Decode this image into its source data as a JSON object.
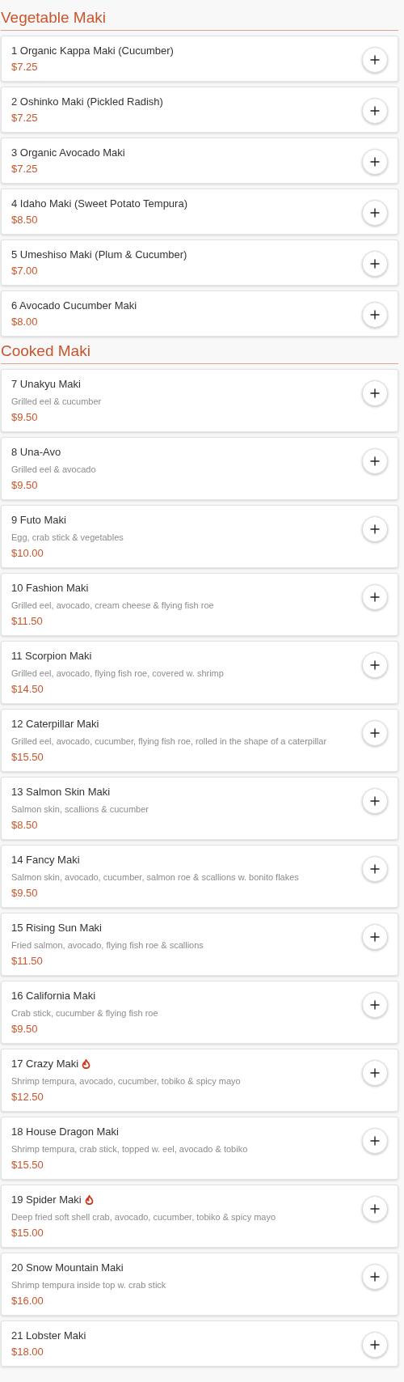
{
  "sections": [
    {
      "title": "Vegetable Maki",
      "items": [
        {
          "name": "1 Organic Kappa Maki (Cucumber)",
          "price": "$7.25",
          "spicy": false
        },
        {
          "name": "2 Oshinko Maki (Pickled Radish)",
          "price": "$7.25",
          "spicy": false
        },
        {
          "name": "3 Organic Avocado Maki",
          "price": "$7.25",
          "spicy": false
        },
        {
          "name": "4 Idaho Maki (Sweet Potato Tempura)",
          "price": "$8.50",
          "spicy": false
        },
        {
          "name": "5 Umeshiso Maki (Plum & Cucumber)",
          "price": "$7.00",
          "spicy": false
        },
        {
          "name": "6 Avocado Cucumber Maki",
          "price": "$8.00",
          "spicy": false
        }
      ]
    },
    {
      "title": "Cooked Maki",
      "items": [
        {
          "name": "7 Unakyu Maki",
          "description": "Grilled eel & cucumber",
          "price": "$9.50",
          "spicy": false
        },
        {
          "name": "8 Una-Avo",
          "description": "Grilled eel & avocado",
          "price": "$9.50",
          "spicy": false
        },
        {
          "name": "9 Futo Maki",
          "description": "Egg, crab stick & vegetables",
          "price": "$10.00",
          "spicy": false
        },
        {
          "name": "10 Fashion Maki",
          "description": "Grilled eel, avocado, cream cheese & flying fish roe",
          "price": "$11.50",
          "spicy": false
        },
        {
          "name": "11 Scorpion Maki",
          "description": "Grilled eel, avocado, flying fish roe, covered w. shrimp",
          "price": "$14.50",
          "spicy": false
        },
        {
          "name": "12 Caterpillar Maki",
          "description": "Grilled eel, avocado, cucumber, flying fish roe, rolled in the shape of a caterpillar",
          "price": "$15.50",
          "spicy": false
        },
        {
          "name": "13 Salmon Skin Maki",
          "description": "Salmon skin, scallions & cucumber",
          "price": "$8.50",
          "spicy": false
        },
        {
          "name": "14 Fancy Maki",
          "description": "Salmon skin, avocado, cucumber, salmon roe & scallions w. bonito flakes",
          "price": "$9.50",
          "spicy": false
        },
        {
          "name": "15 Rising Sun Maki",
          "description": "Fried salmon, avocado, flying fish roe & scallions",
          "price": "$11.50",
          "spicy": false
        },
        {
          "name": "16 California Maki",
          "description": "Crab stick, cucumber & flying fish roe",
          "price": "$9.50",
          "spicy": false
        },
        {
          "name": "17 Crazy Maki",
          "description": "Shrimp tempura, avocado, cucumber, tobiko & spicy mayo",
          "price": "$12.50",
          "spicy": true
        },
        {
          "name": "18 House Dragon Maki",
          "description": "Shrimp tempura, crab stick, topped w. eel, avocado & tobiko",
          "price": "$15.50",
          "spicy": false
        },
        {
          "name": "19 Spider Maki",
          "description": "Deep fried soft shell crab, avocado, cucumber, tobiko & spicy mayo",
          "price": "$15.00",
          "spicy": true
        },
        {
          "name": "20 Snow Mountain Maki",
          "description": "Shrimp tempura inside top w. crab stick",
          "price": "$16.00",
          "spicy": false
        },
        {
          "name": "21 Lobster Maki",
          "price": "$18.00",
          "spicy": false
        }
      ]
    }
  ]
}
